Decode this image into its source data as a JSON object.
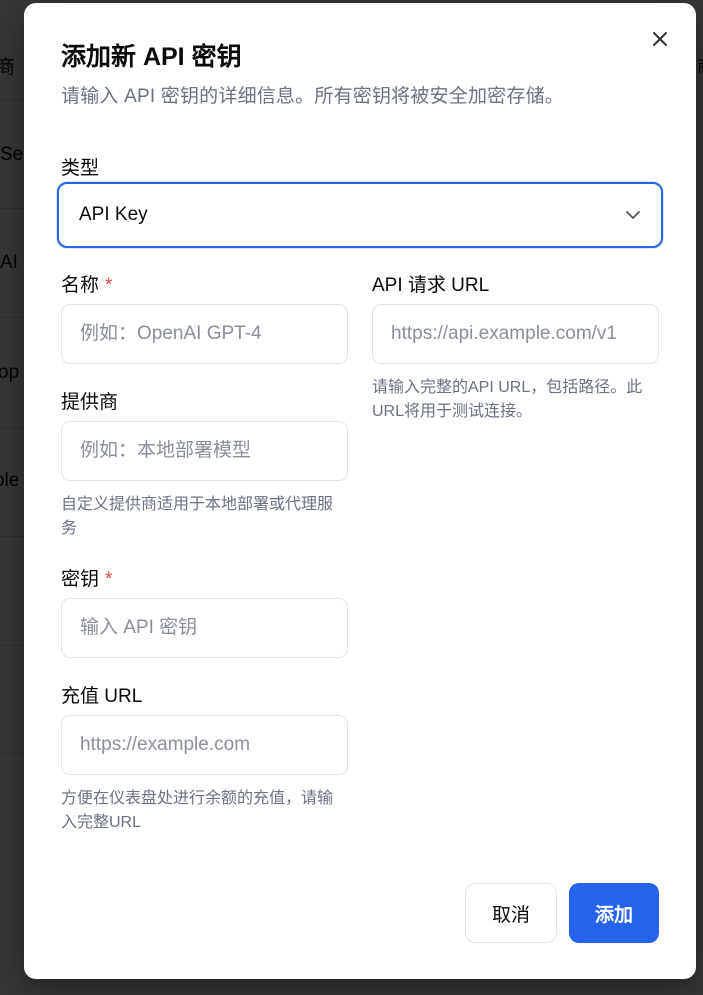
{
  "background": {
    "fragments": [
      "商",
      "Se",
      "AI",
      "op",
      "ole"
    ],
    "right_fragment": "商"
  },
  "dialog": {
    "title": "添加新 API 密钥",
    "subtitle": "请输入 API 密钥的详细信息。所有密钥将被安全加密存储。",
    "close_icon": "close-icon"
  },
  "form": {
    "type": {
      "label": "类型",
      "value": "API Key",
      "icon": "chevron-down-icon"
    },
    "name": {
      "label": "名称",
      "required_mark": "*",
      "placeholder": "例如：OpenAI GPT-4"
    },
    "api_url": {
      "label": "API 请求 URL",
      "placeholder": "https://api.example.com/v1",
      "help": "请输入完整的API URL，包括路径。此URL将用于测试连接。"
    },
    "provider": {
      "label": "提供商",
      "placeholder": "例如：本地部署模型",
      "help": "自定义提供商适用于本地部署或代理服务"
    },
    "key": {
      "label": "密钥",
      "required_mark": "*",
      "placeholder": "输入 API 密钥"
    },
    "recharge_url": {
      "label": "充值 URL",
      "placeholder": "https://example.com",
      "help": "方便在仪表盘处进行余额的充值，请输入完整URL"
    }
  },
  "buttons": {
    "cancel": "取消",
    "add": "添加"
  },
  "colors": {
    "primary": "#2563eb",
    "required": "#ef4444",
    "muted_text": "#6b7280"
  }
}
